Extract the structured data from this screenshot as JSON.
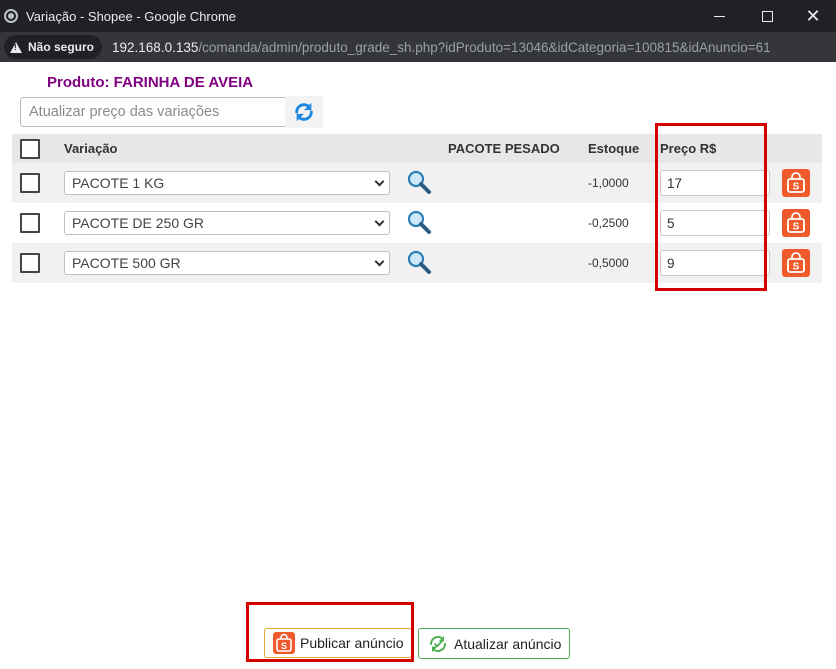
{
  "window": {
    "title": "Variação - Shopee - Google Chrome"
  },
  "address_bar": {
    "security_label": "Não seguro",
    "host": "192.168.0.135",
    "path": "/comanda/admin/produto_grade_sh.php?idProduto=13046&idCategoria=100815&idAnuncio=61"
  },
  "page": {
    "product_title": "Produto: FARINHA DE AVEIA",
    "price_update_placeholder": "Atualizar preço das variações"
  },
  "table": {
    "headers": {
      "variation": "Variação",
      "attribute": "PACOTE PESADO",
      "stock": "Estoque",
      "price": "Preço R$"
    },
    "rows": [
      {
        "variation": "PACOTE 1 KG",
        "stock": "-1,0000",
        "price": "17"
      },
      {
        "variation": "PACOTE DE 250 GR",
        "stock": "-0,2500",
        "price": "5"
      },
      {
        "variation": "PACOTE 500 GR",
        "stock": "-0,5000",
        "price": "9"
      }
    ]
  },
  "actions": {
    "publish_label": "Publicar anúncio",
    "update_label": "Atualizar anúncio"
  },
  "colors": {
    "product_title": "#800080",
    "shopee_orange": "#ee5a2c",
    "highlight_red": "#d40000",
    "refresh_blue": "#1e88e5",
    "update_green": "#4caf50"
  },
  "icons": [
    "refresh-icon",
    "search-icon",
    "shopee-bag-icon",
    "warning-icon",
    "sync-icon"
  ]
}
